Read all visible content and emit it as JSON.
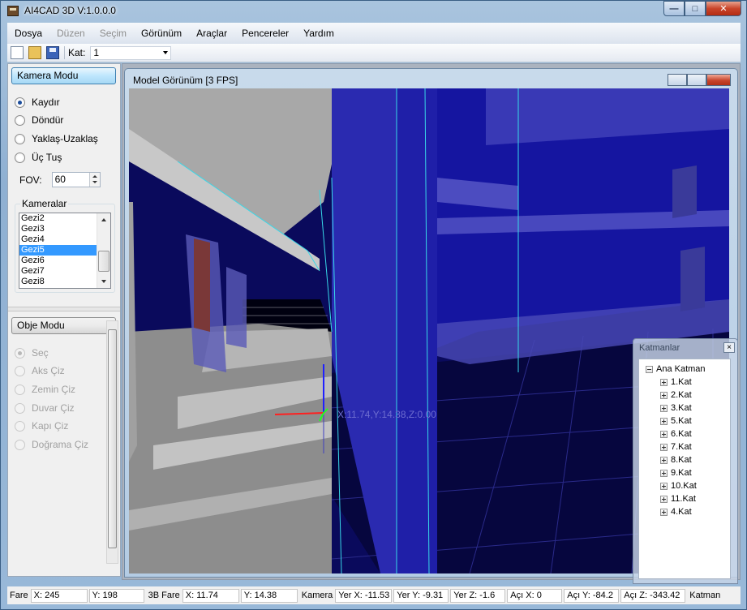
{
  "window": {
    "title": "AI4CAD 3D V:1.0.0.0"
  },
  "menu": [
    {
      "label": "Dosya",
      "enabled": true
    },
    {
      "label": "Düzen",
      "enabled": false
    },
    {
      "label": "Seçim",
      "enabled": false
    },
    {
      "label": "Görünüm",
      "enabled": true
    },
    {
      "label": "Araçlar",
      "enabled": true
    },
    {
      "label": "Pencereler",
      "enabled": true
    },
    {
      "label": "Yardım",
      "enabled": true
    }
  ],
  "toolbar": {
    "kat_label": "Kat:",
    "kat_value": "1"
  },
  "camera_panel": {
    "header": "Kamera Modu",
    "modes": [
      {
        "label": "Kaydır",
        "checked": true
      },
      {
        "label": "Döndür",
        "checked": false
      },
      {
        "label": "Yaklaş-Uzaklaş",
        "checked": false
      },
      {
        "label": "Üç Tuş",
        "checked": false
      }
    ],
    "fov_label": "FOV:",
    "fov_value": "60",
    "cameras_label": "Kameralar",
    "cameras": [
      "Gezi2",
      "Gezi3",
      "Gezi4",
      "Gezi5",
      "Gezi6",
      "Gezi7",
      "Gezi8"
    ],
    "selected_camera": "Gezi5"
  },
  "object_panel": {
    "header": "Obje Modu",
    "modes": [
      {
        "label": "Seç",
        "checked": true
      },
      {
        "label": "Aks Çiz",
        "checked": false
      },
      {
        "label": "Zemin Çiz",
        "checked": false
      },
      {
        "label": "Duvar Çiz",
        "checked": false
      },
      {
        "label": "Kapı Çiz",
        "checked": false
      },
      {
        "label": "Doğrama Çiz",
        "checked": false
      }
    ]
  },
  "model_view": {
    "title": "Model Görünüm [3 FPS]",
    "coord_label": "X:11.74,Y:14.38,Z:0.00",
    "colors": {
      "sky": "#0a0a6a",
      "wall_blue": "#1a1aa0",
      "floor_grey": "#9a9a9a",
      "edge_cyan": "#38d8e8"
    }
  },
  "layers_panel": {
    "title": "Katmanlar",
    "root": "Ana Katman",
    "items": [
      "1.Kat",
      "2.Kat",
      "3.Kat",
      "5.Kat",
      "6.Kat",
      "7.Kat",
      "8.Kat",
      "9.Kat",
      "10.Kat",
      "11.Kat",
      "4.Kat"
    ]
  },
  "statusbar": {
    "fare_label": "Fare",
    "fare_x": "X: 245",
    "fare_y": "Y: 198",
    "fare3d_label": "3B Fare",
    "fare3d_x": "X: 11.74",
    "fare3d_y": "Y: 14.38",
    "kamera_label": "Kamera",
    "yer_x": "Yer X: -11.53",
    "yer_y": "Yer Y: -9.31",
    "yer_z": "Yer Z: -1.6",
    "aci_x": "Açı X: 0",
    "aci_y": "Açı Y: -84.2",
    "aci_z": "Açı Z: -343.42",
    "katman_label": "Katman"
  }
}
